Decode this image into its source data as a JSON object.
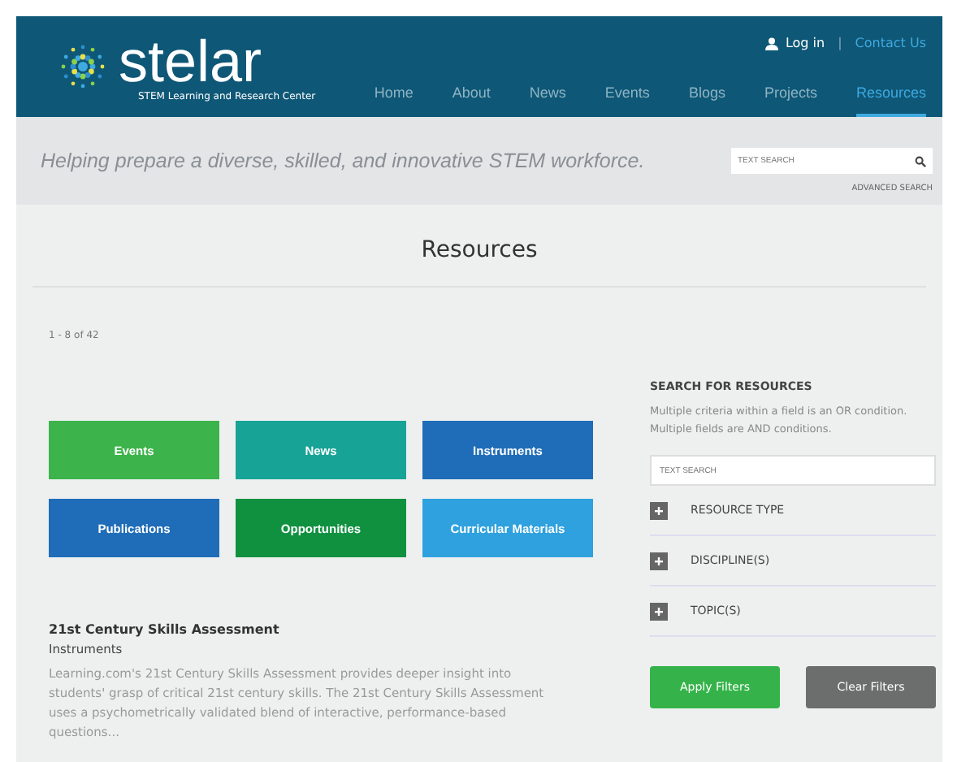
{
  "header": {
    "logo": "stelar",
    "logo_subtitle": "STEM Learning and Research Center",
    "login": "Log in",
    "separator": "|",
    "contact": "Contact Us",
    "nav": [
      {
        "label": "Home",
        "selected": false
      },
      {
        "label": "About",
        "selected": false
      },
      {
        "label": "News",
        "selected": false
      },
      {
        "label": "Events",
        "selected": false
      },
      {
        "label": "Blogs",
        "selected": false
      },
      {
        "label": "Projects",
        "selected": false
      },
      {
        "label": "Resources",
        "selected": true
      }
    ]
  },
  "banner": {
    "tagline": "Helping prepare a diverse, skilled, and innovative STEM workforce.",
    "search": {
      "placeholder": "TEXT SEARCH"
    },
    "advanced_search": "ADVANCED SEARCH"
  },
  "page_title": "Resources",
  "result_count": "1 - 8 of 42",
  "categories": [
    {
      "label": "Events",
      "color": "#3cb44b"
    },
    {
      "label": "News",
      "color": "#17a396"
    },
    {
      "label": "Instruments",
      "color": "#1f6db8"
    },
    {
      "label": "Publications",
      "color": "#1f6db8"
    },
    {
      "label": "Opportunities",
      "color": "#0f9140"
    },
    {
      "label": "Curricular Materials",
      "color": "#2ea1de"
    }
  ],
  "result": {
    "title": "21st Century Skills Assessment",
    "type": "Instruments",
    "description": "Learning.com's 21st Century Skills Assessment provides deeper insight into students' grasp of critical 21st century skills.  The 21st Century Skills Assessment uses a psychometrically validated blend of interactive, performance-based questions..."
  },
  "sidebar": {
    "heading": "SEARCH FOR RESOURCES",
    "note": "Multiple criteria within a field is an OR condition. Multiple fields are AND conditions.",
    "search": {
      "placeholder": "TEXT SEARCH"
    },
    "filters": [
      {
        "label": "RESOURCE TYPE",
        "expanded": false
      },
      {
        "label": "DISCIPLINE(S)",
        "expanded": false
      },
      {
        "label": "TOPIC(S)",
        "expanded": false
      }
    ],
    "buttons": [
      {
        "label": "Apply Filters",
        "kind": "primary"
      },
      {
        "label": "Clear Filters",
        "kind": "secondary"
      }
    ]
  }
}
